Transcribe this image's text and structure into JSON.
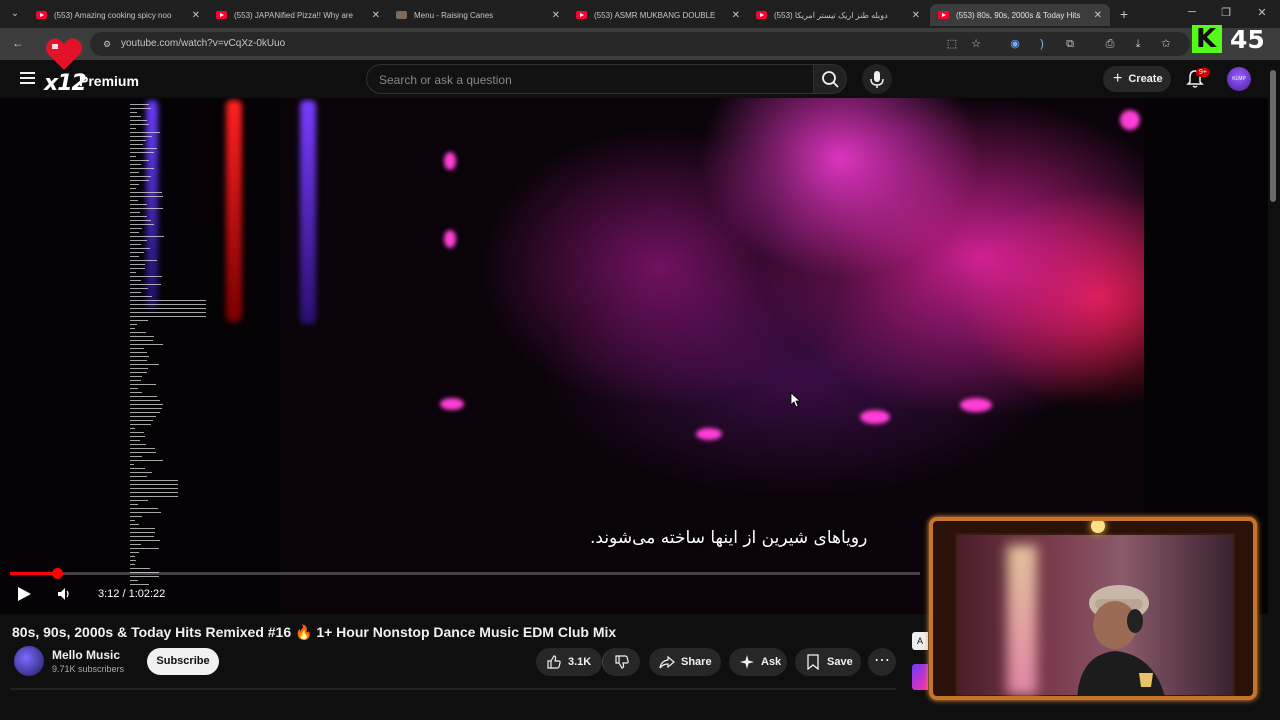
{
  "browser": {
    "tabs": [
      {
        "title": "(553) Amazing cooking spicy noo",
        "type": "youtube"
      },
      {
        "title": "(553) JAPANified Pizza!! Why are",
        "type": "youtube"
      },
      {
        "title": "Menu - Raising Canes",
        "type": "menu"
      },
      {
        "title": "(553) ASMR MUKBANG DOUBLE",
        "type": "youtube"
      },
      {
        "title": "(553) دوبله طنز اریک تیستر آمریکا",
        "type": "youtube"
      },
      {
        "title": "(553) 80s, 90s, 2000s & Today Hits",
        "type": "youtube",
        "active": true
      }
    ],
    "url": "youtube.com/watch?v=vCqXz-0kUuo"
  },
  "youtube": {
    "logo_text": "x12",
    "premium_label": "Premium",
    "search_placeholder": "Search or ask a question",
    "create_label": "Create",
    "notification_count": "9+",
    "avatar_text": "KLMP"
  },
  "player": {
    "subtitle": "رویاهای شیرین از اینها ساخته می‌شوند.",
    "time": "3:12 / 1:02:22",
    "progress_fraction": 0.0512
  },
  "video": {
    "title": "80s, 90s, 2000s & Today Hits Remixed #16 🔥 1+ Hour Nonstop Dance Music EDM Club Mix",
    "channel": "Mello Music",
    "subscribers": "9.71K subscribers",
    "subscribe_label": "Subscribe",
    "likes": "3.1K",
    "share_label": "Share",
    "ask_label": "Ask",
    "save_label": "Save"
  },
  "overlay": {
    "kick_letter": "K",
    "viewer_count": "45",
    "side_chip": "A"
  },
  "colors": {
    "accent": "#ff0000",
    "kick_green": "#53fc18",
    "webcam_border": "#c9742b"
  }
}
